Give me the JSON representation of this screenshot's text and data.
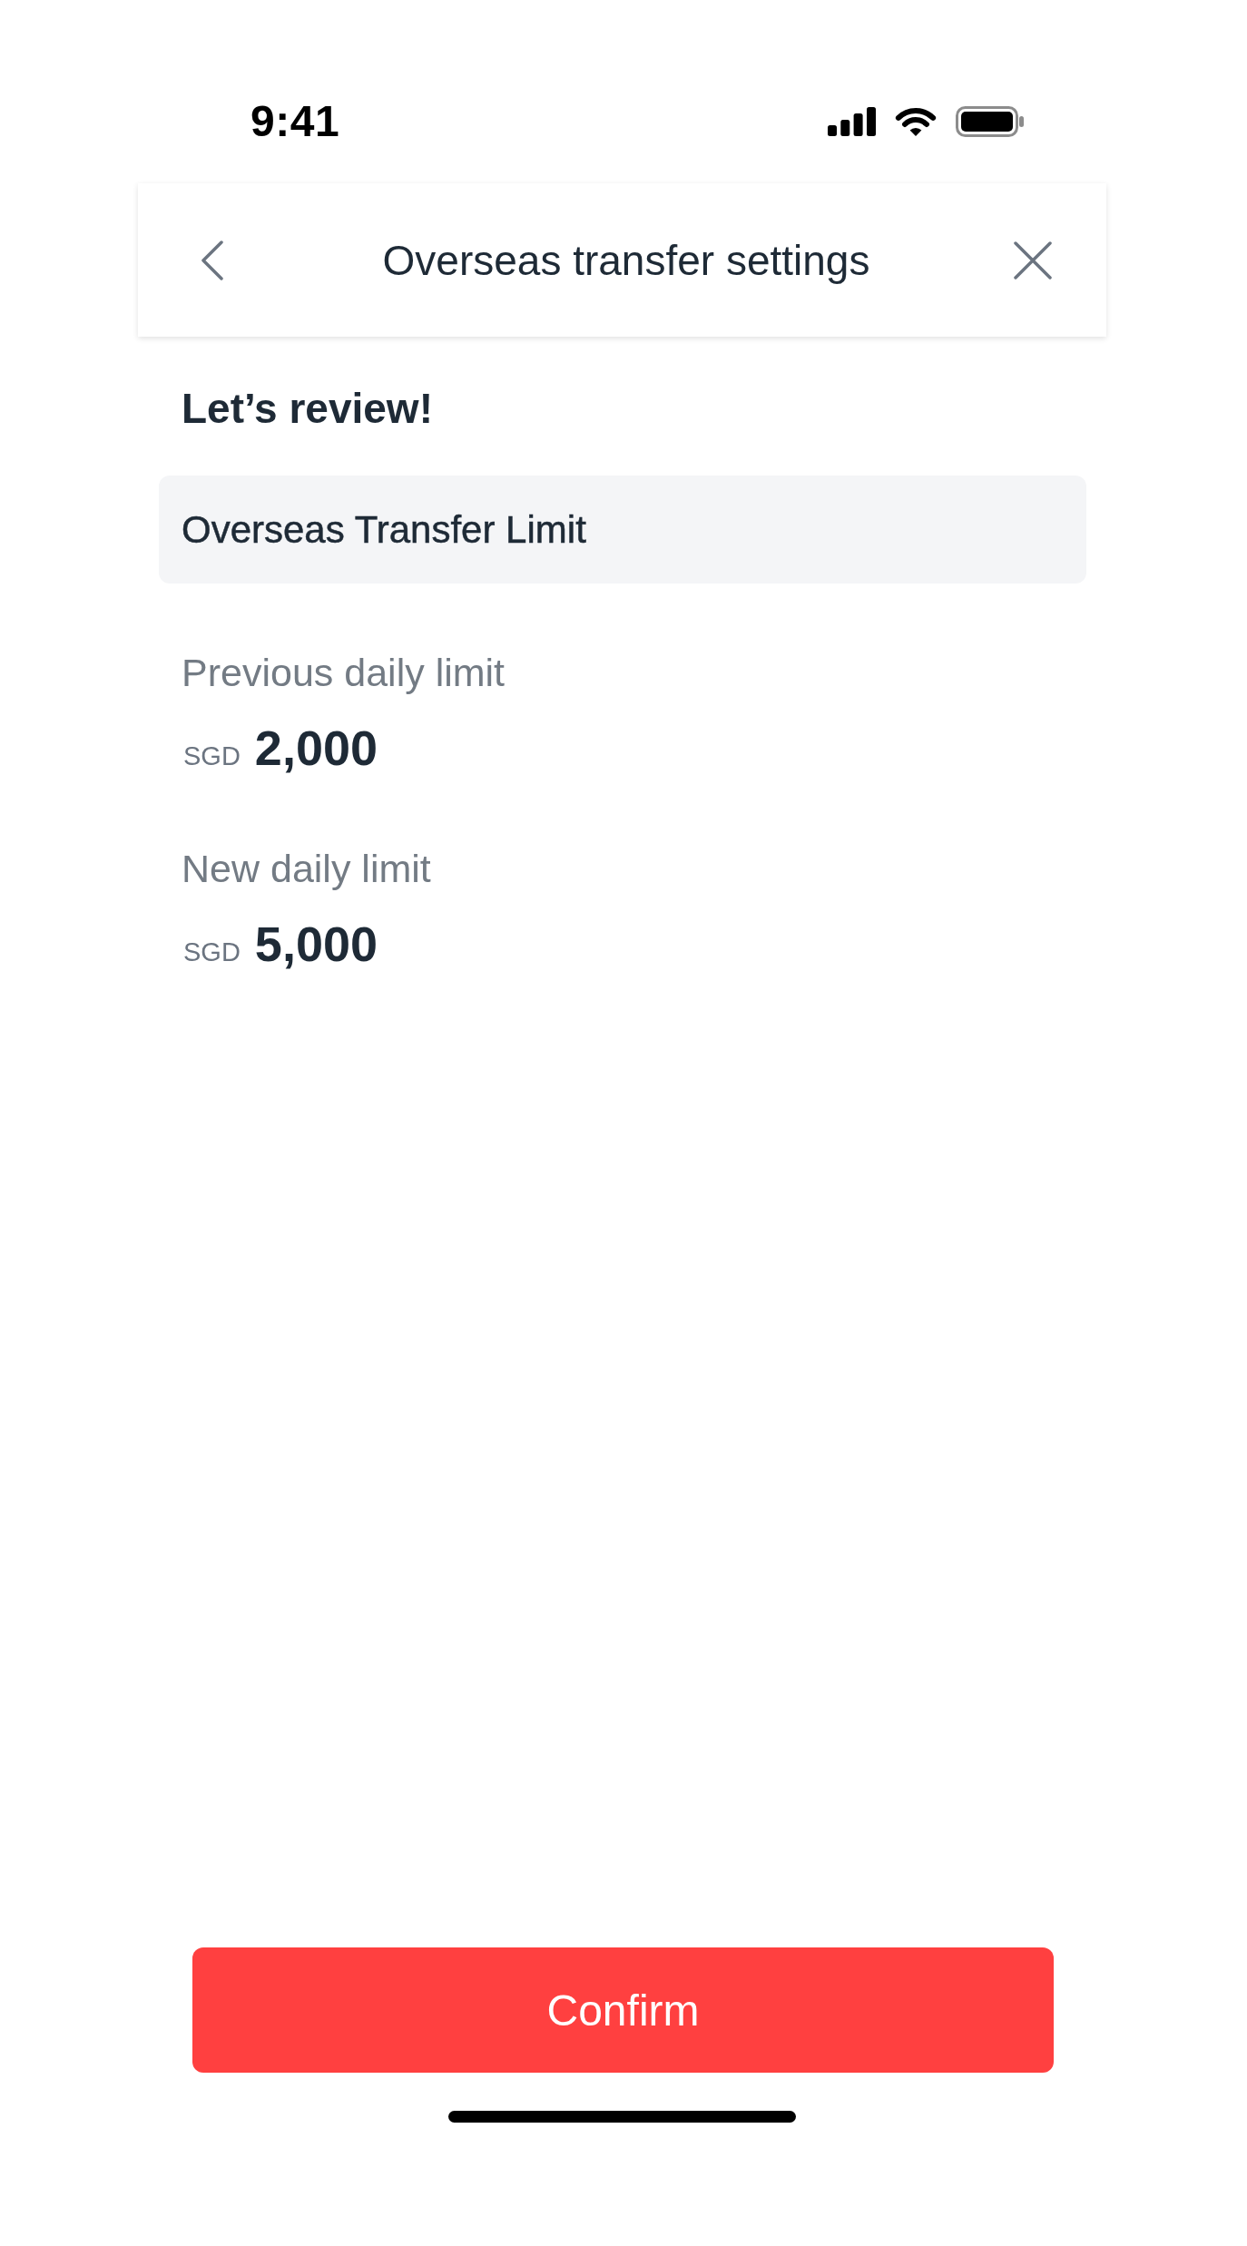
{
  "status_bar": {
    "time": "9:41"
  },
  "header": {
    "title": "Overseas transfer settings"
  },
  "heading": "Let’s review!",
  "section": {
    "title": "Overseas Transfer Limit"
  },
  "limits": [
    {
      "label": "Previous daily limit",
      "currency": "SGD",
      "amount": "2,000"
    },
    {
      "label": "New daily limit",
      "currency": "SGD",
      "amount": "5,000"
    }
  ],
  "confirm_button": {
    "label": "Confirm"
  }
}
